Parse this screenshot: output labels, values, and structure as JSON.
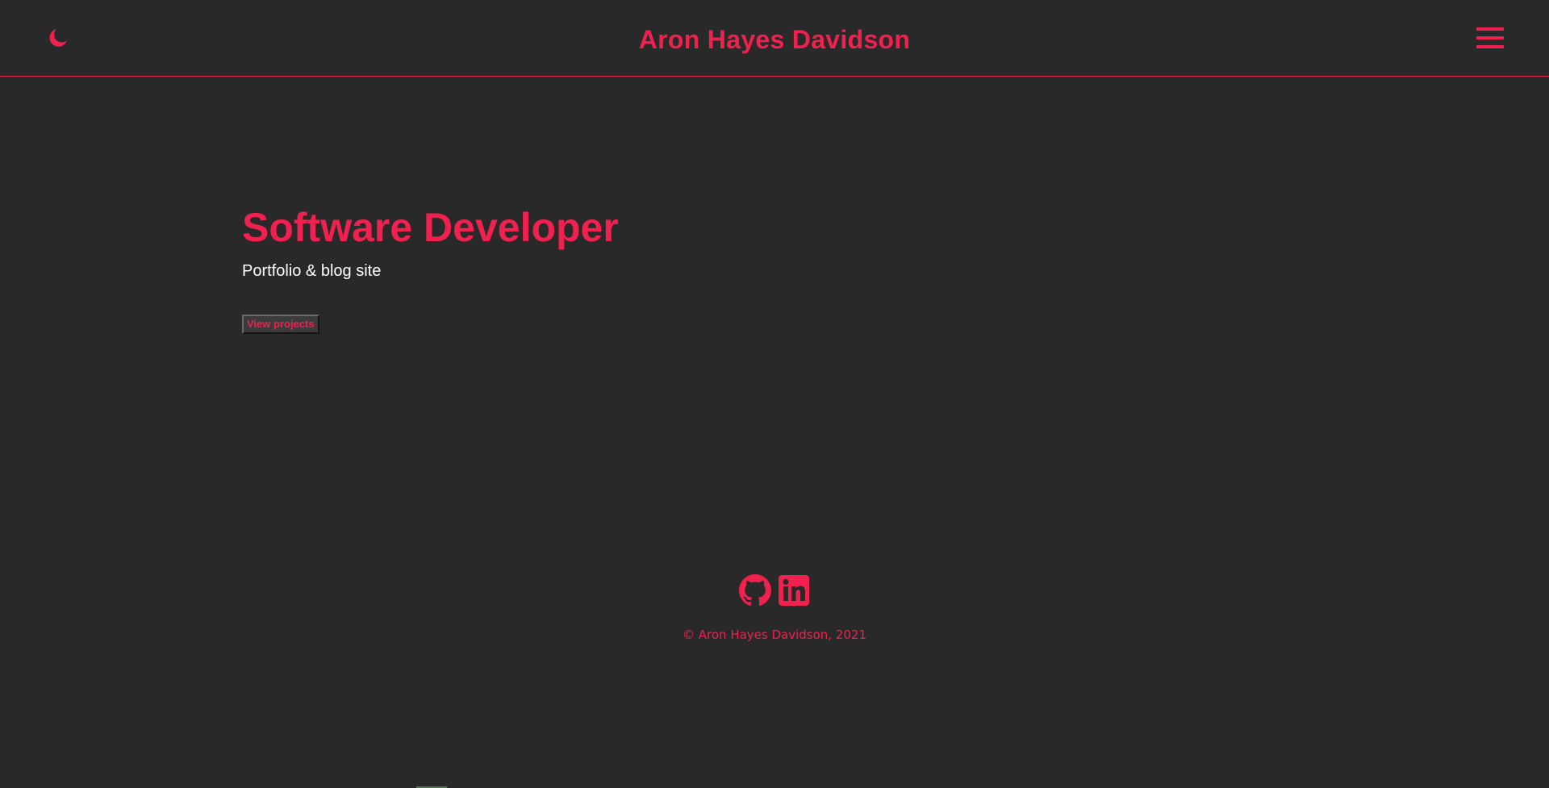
{
  "header": {
    "title": "Aron Hayes Davidson",
    "theme_toggle_icon": "moon-icon",
    "menu_icon": "hamburger-menu-icon"
  },
  "hero": {
    "title": "Software Developer",
    "subtitle": "Portfolio & blog site",
    "button_label": "View projects"
  },
  "footer": {
    "social": [
      {
        "icon": "github-icon"
      },
      {
        "icon": "linkedin-icon"
      }
    ],
    "copyright": "© Aron Hayes Davidson, 2021"
  },
  "colors": {
    "accent": "#f0214f",
    "background": "#292929",
    "text": "#ffffff"
  }
}
